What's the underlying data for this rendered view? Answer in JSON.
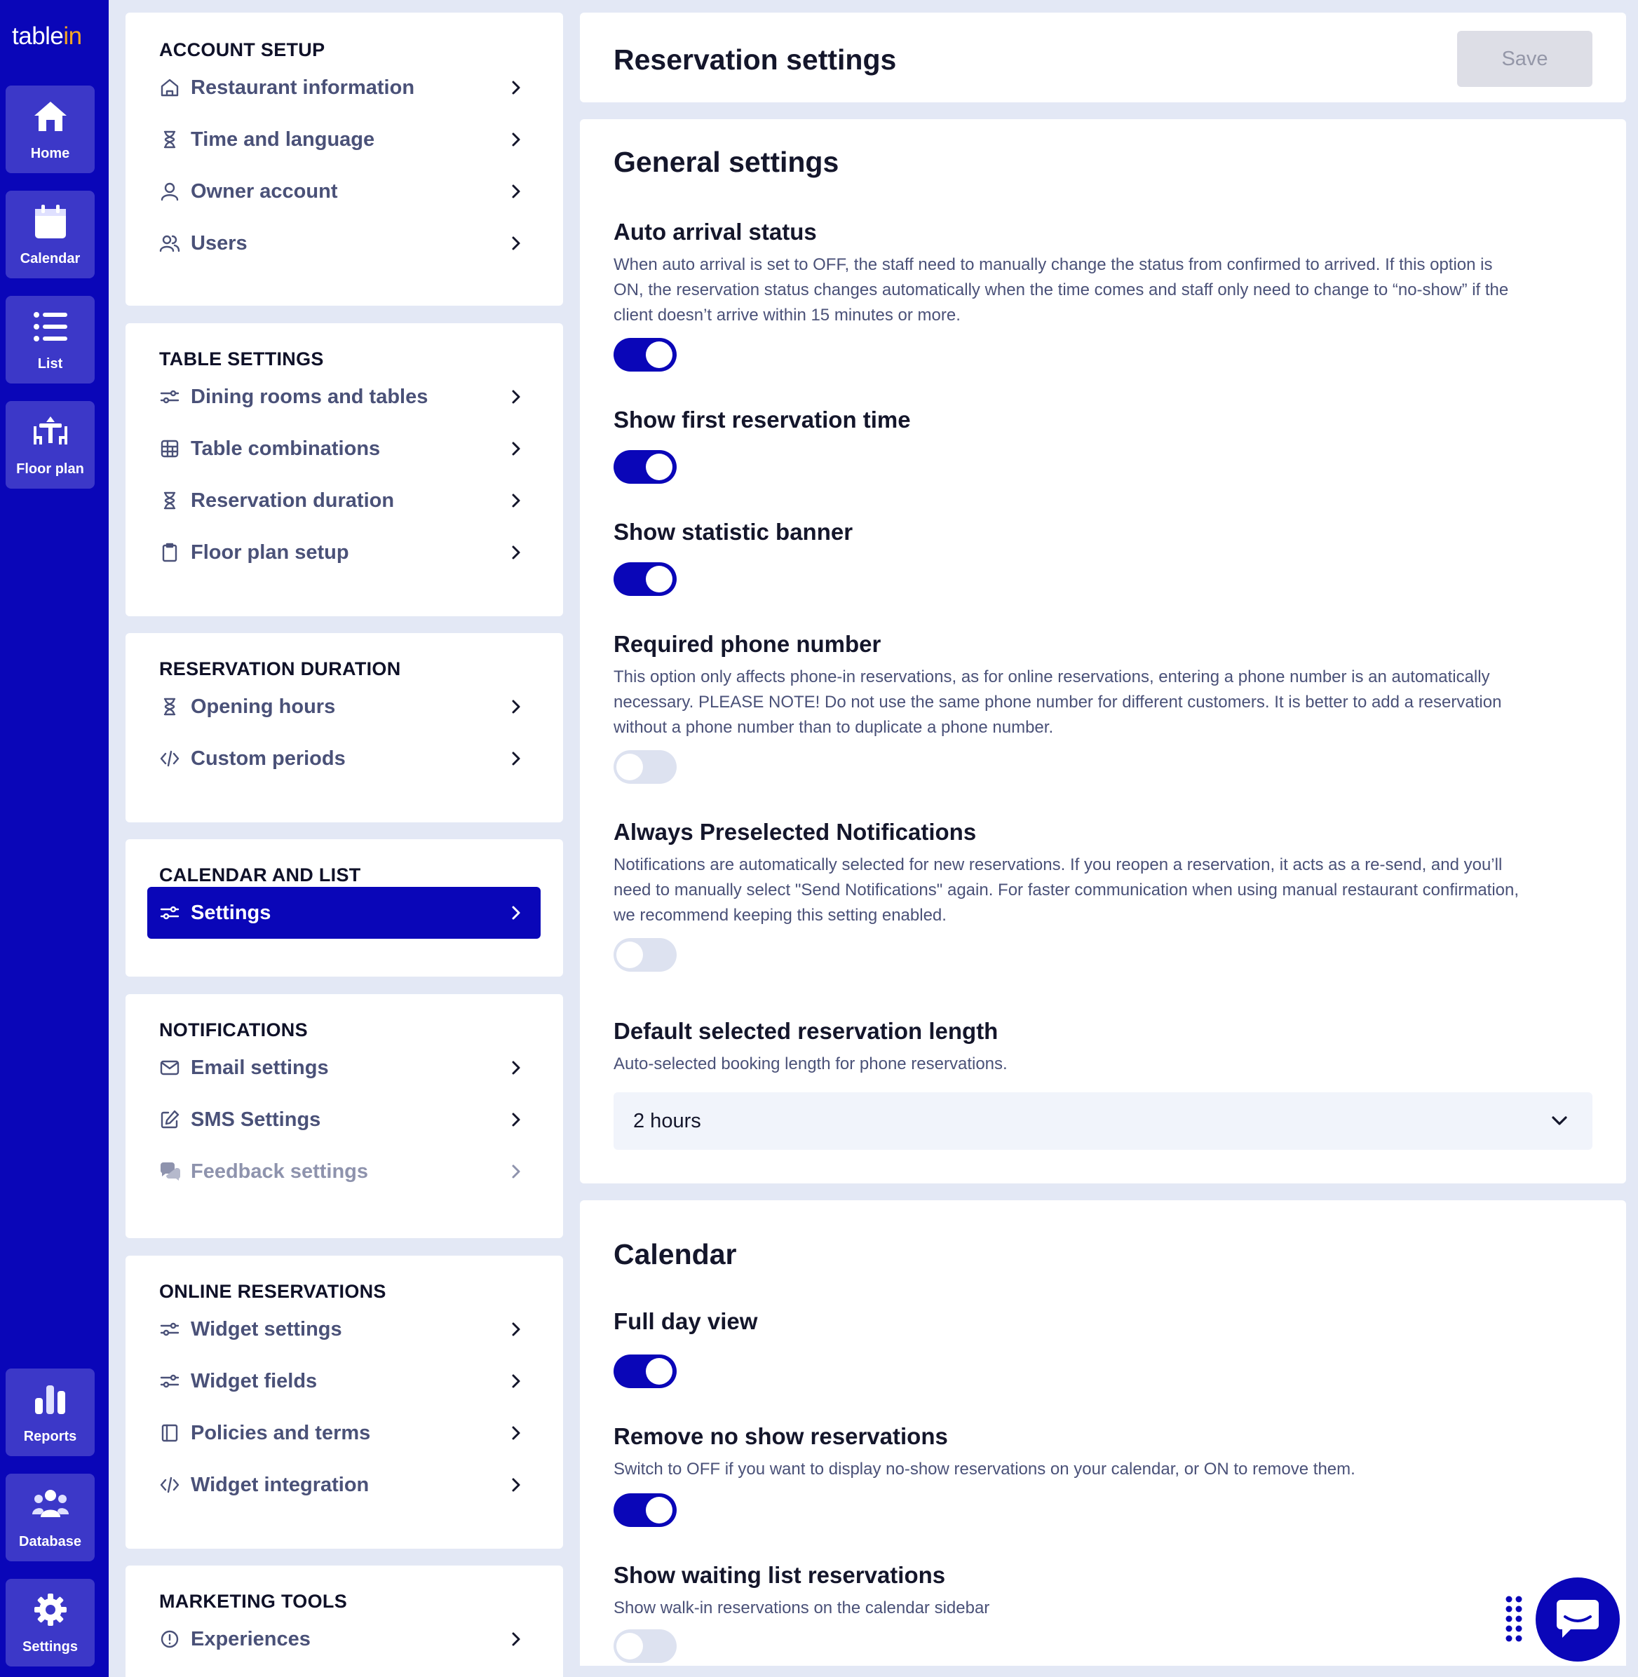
{
  "brand": {
    "name_a": "table",
    "name_b": "in",
    "accent": "#0a06b8",
    "logo_accent": "#f7a623"
  },
  "rail": {
    "top": [
      {
        "label": "Home",
        "icon": "home-icon"
      },
      {
        "label": "Calendar",
        "icon": "calendar-icon"
      },
      {
        "label": "List",
        "icon": "list-icon"
      },
      {
        "label": "Floor plan",
        "icon": "floor-plan-icon"
      }
    ],
    "bottom": [
      {
        "label": "Reports",
        "icon": "reports-icon"
      },
      {
        "label": "Database",
        "icon": "database-icon"
      },
      {
        "label": "Settings",
        "icon": "settings-icon"
      }
    ]
  },
  "menu": [
    {
      "title": "ACCOUNT SETUP",
      "items": [
        {
          "label": "Restaurant information",
          "icon": "home-outline-icon"
        },
        {
          "label": "Time and language",
          "icon": "hourglass-icon"
        },
        {
          "label": "Owner account",
          "icon": "user-icon"
        },
        {
          "label": "Users",
          "icon": "users-icon"
        }
      ]
    },
    {
      "title": "TABLE SETTINGS",
      "items": [
        {
          "label": "Dining rooms and tables",
          "icon": "sliders-icon"
        },
        {
          "label": "Table combinations",
          "icon": "grid-icon"
        },
        {
          "label": "Reservation duration",
          "icon": "hourglass-icon"
        },
        {
          "label": "Floor plan setup",
          "icon": "clipboard-icon"
        }
      ]
    },
    {
      "title": "RESERVATION DURATION",
      "items": [
        {
          "label": "Opening hours",
          "icon": "hourglass-icon"
        },
        {
          "label": "Custom periods",
          "icon": "code-icon"
        }
      ]
    },
    {
      "title": "CALENDAR AND LIST",
      "items": [
        {
          "label": "Settings",
          "icon": "sliders-icon",
          "active": true
        }
      ]
    },
    {
      "title": "NOTIFICATIONS",
      "items": [
        {
          "label": "Email settings",
          "icon": "mail-icon"
        },
        {
          "label": "SMS Settings",
          "icon": "edit-icon"
        },
        {
          "label": "Feedback settings",
          "icon": "chat-bubbles-icon"
        }
      ]
    },
    {
      "title": "ONLINE RESERVATIONS",
      "items": [
        {
          "label": "Widget settings",
          "icon": "sliders-icon"
        },
        {
          "label": "Widget fields",
          "icon": "sliders-icon"
        },
        {
          "label": "Policies and terms",
          "icon": "book-icon"
        },
        {
          "label": "Widget integration",
          "icon": "code-icon"
        }
      ]
    },
    {
      "title": "MARKETING TOOLS",
      "items": [
        {
          "label": "Experiences",
          "icon": "info-circle-icon"
        }
      ]
    }
  ],
  "header": {
    "title": "Reservation settings",
    "save_label": "Save"
  },
  "general": {
    "title": "General settings",
    "settings": [
      {
        "title": "Auto arrival status",
        "desc": [
          "When auto arrival is set to OFF, the staff need to manually change the status from confirmed to arrived. If this option is",
          "ON, the reservation status changes automatically when the time comes and staff only need to change to “no-show” if the",
          "client doesn’t arrive within 15 minutes or more."
        ],
        "on": true
      },
      {
        "title": "Show first reservation time",
        "desc": [],
        "on": true
      },
      {
        "title": "Show statistic banner",
        "desc": [],
        "on": true
      },
      {
        "title": "Required phone number",
        "desc": [
          "This option only affects phone-in reservations, as for online reservations, entering a phone number is an automatically",
          "necessary. PLEASE NOTE! Do not use the same phone number for different customers. It is better to add a reservation",
          "without a phone number than to duplicate a phone number."
        ],
        "on": false
      },
      {
        "title": "Always Preselected Notifications",
        "desc": [
          "Notifications are automatically selected for new reservations. If you reopen a reservation, it acts as a re-send, and you’ll",
          "need to manually select \"Send Notifications\" again. For faster communication when using manual restaurant confirmation,",
          "we recommend keeping this setting enabled."
        ],
        "on": false
      }
    ],
    "length": {
      "title": "Default selected reservation length",
      "desc": "Auto-selected booking length for phone reservations.",
      "value": "2 hours"
    }
  },
  "calendar": {
    "title": "Calendar",
    "settings": [
      {
        "title": "Full day view",
        "desc": [],
        "on": true
      },
      {
        "title": "Remove no show reservations",
        "desc": [
          "Switch to OFF if you want to display no-show reservations on your calendar, or ON to remove them."
        ],
        "on": true
      },
      {
        "title": "Show waiting list reservations",
        "desc": [
          "Show walk-in reservations on the calendar sidebar"
        ],
        "on": false
      }
    ]
  }
}
